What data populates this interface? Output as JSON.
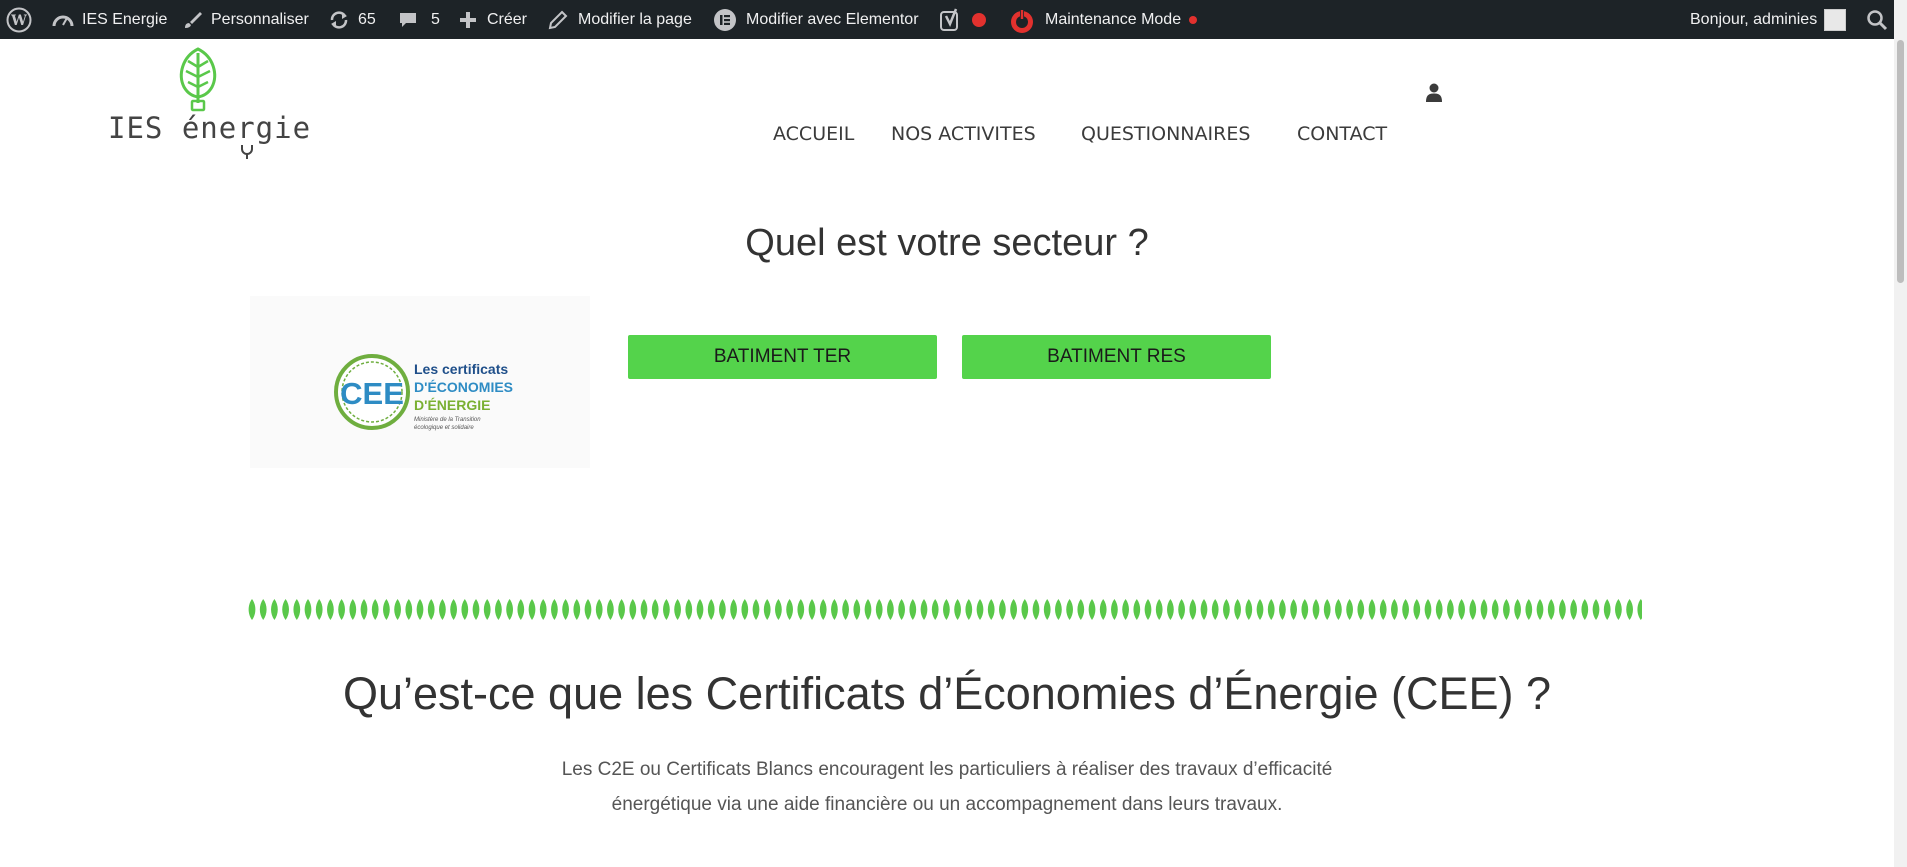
{
  "admin_bar": {
    "site_name": "IES Energie",
    "customize": "Personnaliser",
    "updates_count": "65",
    "comments_count": "5",
    "new_label": "Créer",
    "edit_page": "Modifier la page",
    "elementor": "Modifier avec Elementor",
    "maintenance": "Maintenance Mode",
    "greeting": "Bonjour, adminies",
    "status_color": "#e2312e"
  },
  "header": {
    "logo_text": "IES énergie",
    "nav": [
      {
        "label": "ACCUEIL"
      },
      {
        "label": "NOS ACTIVITES"
      },
      {
        "label": "QUESTIONNAIRES"
      },
      {
        "label": "CONTACT"
      }
    ]
  },
  "sector": {
    "heading": "Quel est votre secteur ?",
    "cee_logo": {
      "badge": "CEE",
      "line1": "Les certificats",
      "line2": "D'ÉCONOMIES",
      "line3": "D'ÉNERGIE",
      "line4": "Ministère de la Transition",
      "line5": "écologique et solidaire"
    },
    "buttons": [
      {
        "label": "BATIMENT TER"
      },
      {
        "label": "BATIMENT RES"
      }
    ],
    "button_color": "#54d34b"
  },
  "cee_section": {
    "heading": "Qu’est-ce que les Certificats d’Économies d’Énergie (CEE) ?",
    "description_line1": "Les C2E ou Certificats Blancs encouragent les particuliers à réaliser des travaux d’efficacité",
    "description_line2": "énergétique via une aide financière ou un accompagnement dans leurs travaux."
  },
  "colors": {
    "brand_green": "#5ac84a",
    "admin_bar_bg": "#1d2327"
  }
}
